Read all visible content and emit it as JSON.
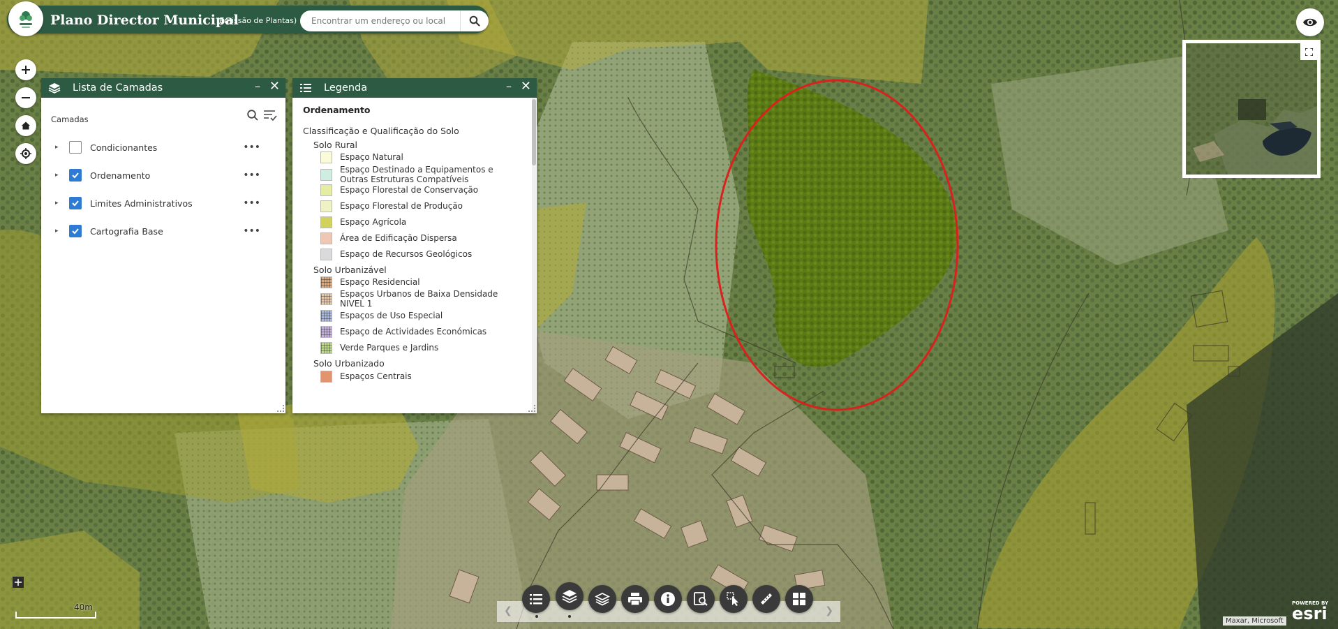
{
  "header": {
    "title": "Plano Director Municipal",
    "subtitle": "(Emissão de Plantas)",
    "search_placeholder": "Encontrar um endereço ou local"
  },
  "layers_panel": {
    "title": "Lista de Camadas",
    "section_label": "Camadas",
    "items": [
      {
        "label": "Condicionantes",
        "checked": false
      },
      {
        "label": "Ordenamento",
        "checked": true
      },
      {
        "label": "Limites Administrativos",
        "checked": true
      },
      {
        "label": "Cartografia Base",
        "checked": true
      }
    ]
  },
  "legend_panel": {
    "title": "Legenda",
    "heading": "Ordenamento",
    "group": "Classificação e Qualificação do Solo",
    "sections": [
      {
        "label": "Solo Rural",
        "items": [
          {
            "label": "Espaço Natural",
            "color": "#fbfbd7"
          },
          {
            "label": "Espaço Destinado a Equipamentos e Outras Estruturas Compatíveis",
            "color": "#cdeee0"
          },
          {
            "label": "Espaço Florestal de Conservação",
            "color": "#e5eca3"
          },
          {
            "label": "Espaço Florestal de Produção",
            "color": "#eef2c4"
          },
          {
            "label": "Espaço Agrícola",
            "color": "#d0d25a"
          },
          {
            "label": "Área de Edificação Dispersa",
            "color": "#efc7b4"
          },
          {
            "label": "Espaço de Recursos Geológicos",
            "color": "#dadadc"
          }
        ]
      },
      {
        "label": "Solo Urbanizável",
        "items": [
          {
            "label": "Espaço Residencial",
            "color": "#e0a97a"
          },
          {
            "label": "Espaços Urbanos de Baixa Densidade NIVEL 1",
            "color": "#e9c7a4"
          },
          {
            "label": "Espaços de Uso Especial",
            "color": "#a6b9e0"
          },
          {
            "label": "Espaço de Actividades Económicas",
            "color": "#c3b0d8"
          },
          {
            "label": "Verde Parques e Jardins",
            "color": "#b9db7c"
          }
        ]
      },
      {
        "label": "Solo Urbanizado",
        "items": [
          {
            "label": "Espaços Centrais",
            "color": "#e2936f"
          }
        ]
      }
    ]
  },
  "scale_bar": {
    "label": "40m"
  },
  "attribution": "Maxar, Microsoft",
  "esri": {
    "powered": "POWERED BY",
    "name": "esri"
  }
}
